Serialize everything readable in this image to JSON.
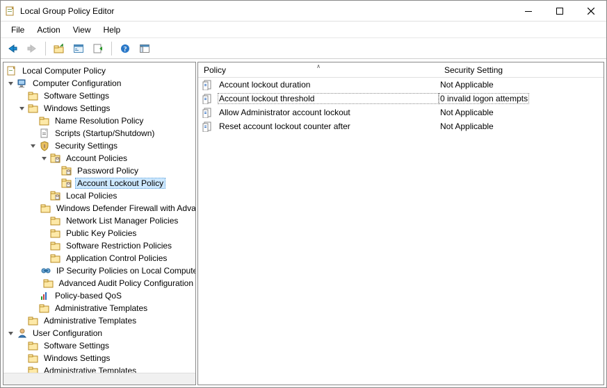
{
  "window": {
    "title": "Local Group Policy Editor"
  },
  "menu": [
    "File",
    "Action",
    "View",
    "Help"
  ],
  "toolbar_icons": {
    "back": "back-arrow-icon",
    "forward": "forward-arrow-icon",
    "up": "folder-up-icon",
    "props": "properties-icon",
    "refresh": "refresh-icon",
    "export": "export-list-icon",
    "help": "help-icon",
    "show": "show-hide-icon"
  },
  "tree": {
    "root": {
      "label": "Local Computer Policy",
      "children": [
        {
          "label": "Computer Configuration",
          "expanded": true,
          "icon": "computer",
          "children": [
            {
              "label": "Software Settings",
              "icon": "folder"
            },
            {
              "label": "Windows Settings",
              "expanded": true,
              "icon": "folder",
              "children": [
                {
                  "label": "Name Resolution Policy",
                  "icon": "folder"
                },
                {
                  "label": "Scripts (Startup/Shutdown)",
                  "icon": "script"
                },
                {
                  "label": "Security Settings",
                  "expanded": true,
                  "icon": "shield",
                  "children": [
                    {
                      "label": "Account Policies",
                      "expanded": true,
                      "icon": "policy",
                      "children": [
                        {
                          "label": "Password Policy",
                          "icon": "policy"
                        },
                        {
                          "label": "Account Lockout Policy",
                          "icon": "policy",
                          "selected": true
                        }
                      ]
                    },
                    {
                      "label": "Local Policies",
                      "icon": "policy"
                    },
                    {
                      "label": "Windows Defender Firewall with Advanced Security",
                      "icon": "folder"
                    },
                    {
                      "label": "Network List Manager Policies",
                      "icon": "folder"
                    },
                    {
                      "label": "Public Key Policies",
                      "icon": "folder"
                    },
                    {
                      "label": "Software Restriction Policies",
                      "icon": "folder"
                    },
                    {
                      "label": "Application Control Policies",
                      "icon": "folder"
                    },
                    {
                      "label": "IP Security Policies on Local Computer",
                      "icon": "ipsec"
                    },
                    {
                      "label": "Advanced Audit Policy Configuration",
                      "icon": "folder"
                    }
                  ]
                },
                {
                  "label": "Policy-based QoS",
                  "icon": "qos"
                },
                {
                  "label": "Administrative Templates",
                  "icon": "folder"
                }
              ]
            },
            {
              "label": "Administrative Templates",
              "icon": "folder"
            }
          ]
        },
        {
          "label": "User Configuration",
          "expanded": true,
          "icon": "user",
          "children": [
            {
              "label": "Software Settings",
              "icon": "folder"
            },
            {
              "label": "Windows Settings",
              "icon": "folder"
            },
            {
              "label": "Administrative Templates",
              "icon": "folder"
            }
          ]
        }
      ]
    }
  },
  "list": {
    "columns": [
      "Policy",
      "Security Setting"
    ],
    "sorted_col": 0,
    "rows": [
      {
        "policy": "Account lockout duration",
        "setting": "Not Applicable",
        "focused": false
      },
      {
        "policy": "Account lockout threshold",
        "setting": "0 invalid logon attempts",
        "focused": true
      },
      {
        "policy": "Allow Administrator account lockout",
        "setting": "Not Applicable",
        "focused": false
      },
      {
        "policy": "Reset account lockout counter after",
        "setting": "Not Applicable",
        "focused": false
      }
    ]
  }
}
